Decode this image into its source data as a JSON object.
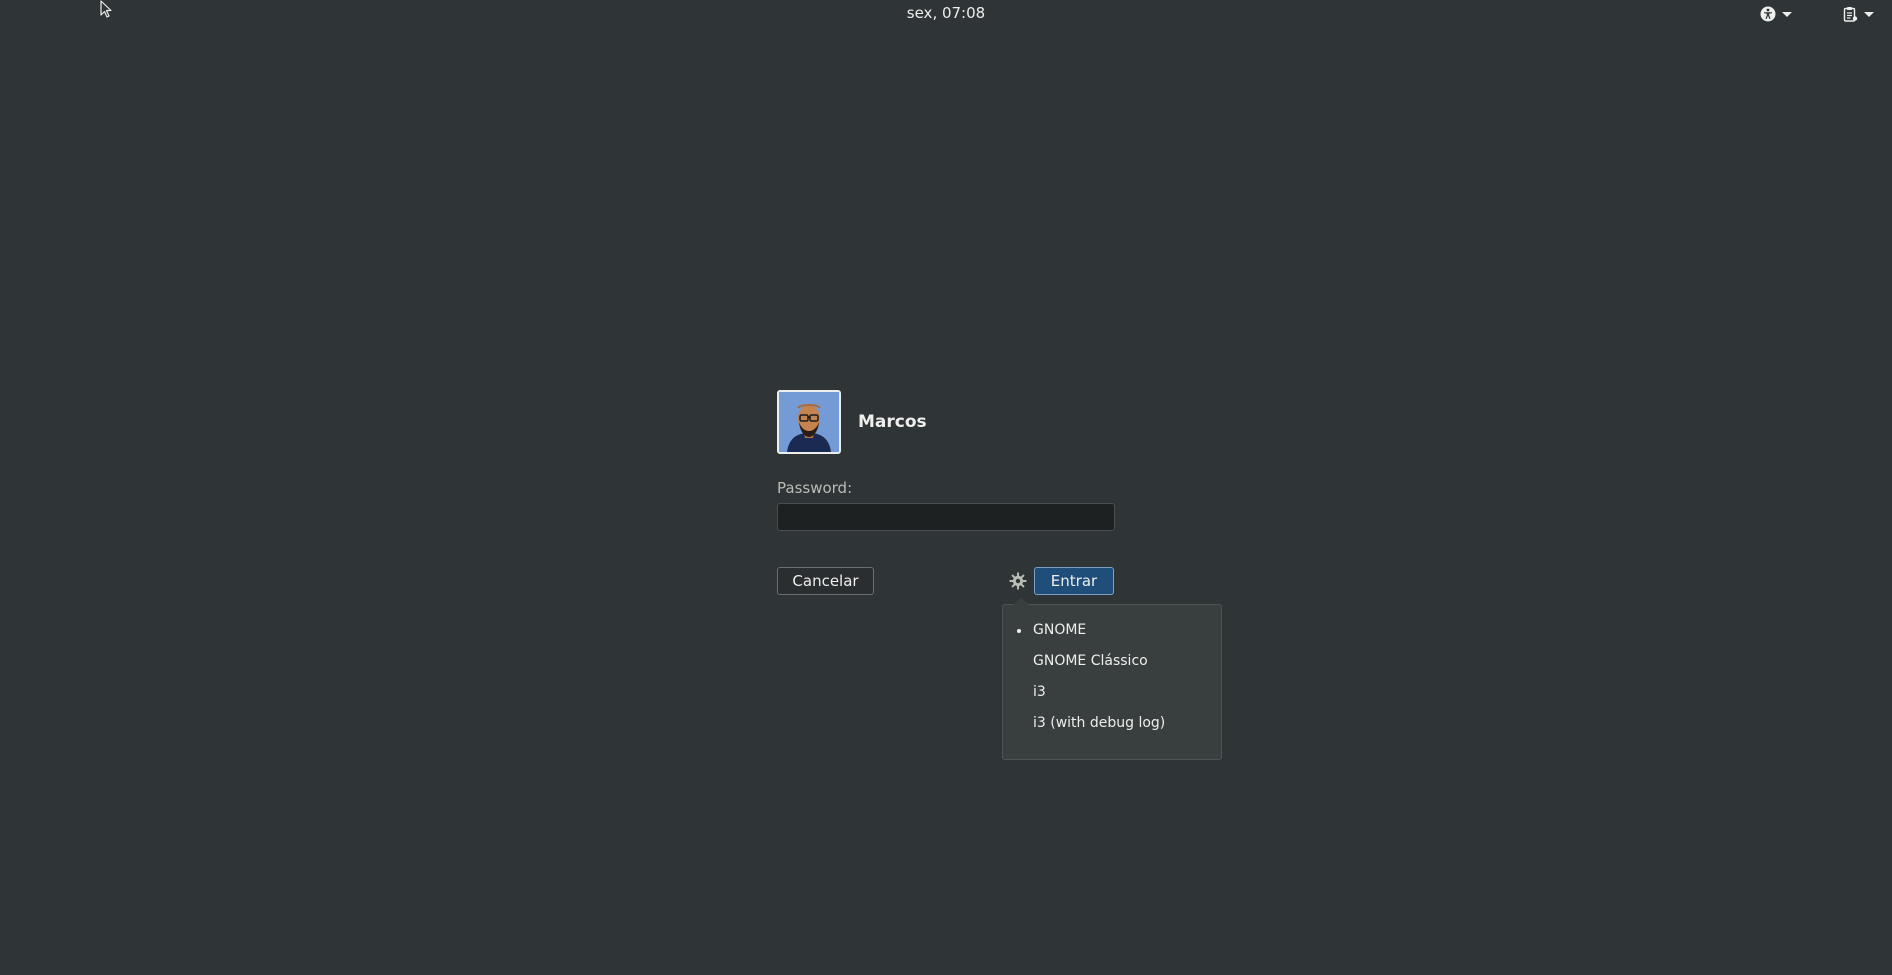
{
  "topbar": {
    "clock": "sex, 07:08",
    "accessibility_icon": "accessibility-icon",
    "clipboard_icon": "clipboard-icon"
  },
  "login": {
    "user_name": "Marcos",
    "password_label": "Password:",
    "password_value": "",
    "cancel_label": "Cancelar",
    "enter_label": "Entrar"
  },
  "session_menu": {
    "selected": "GNOME",
    "items": [
      {
        "label": "GNOME"
      },
      {
        "label": "GNOME Clássico"
      },
      {
        "label": "i3"
      },
      {
        "label": "i3 (with debug log)"
      }
    ]
  },
  "colors": {
    "background": "#2f3437",
    "accent_button": "#1f4e7a",
    "menu_background": "#393f3f",
    "text": "#eeeeec"
  }
}
